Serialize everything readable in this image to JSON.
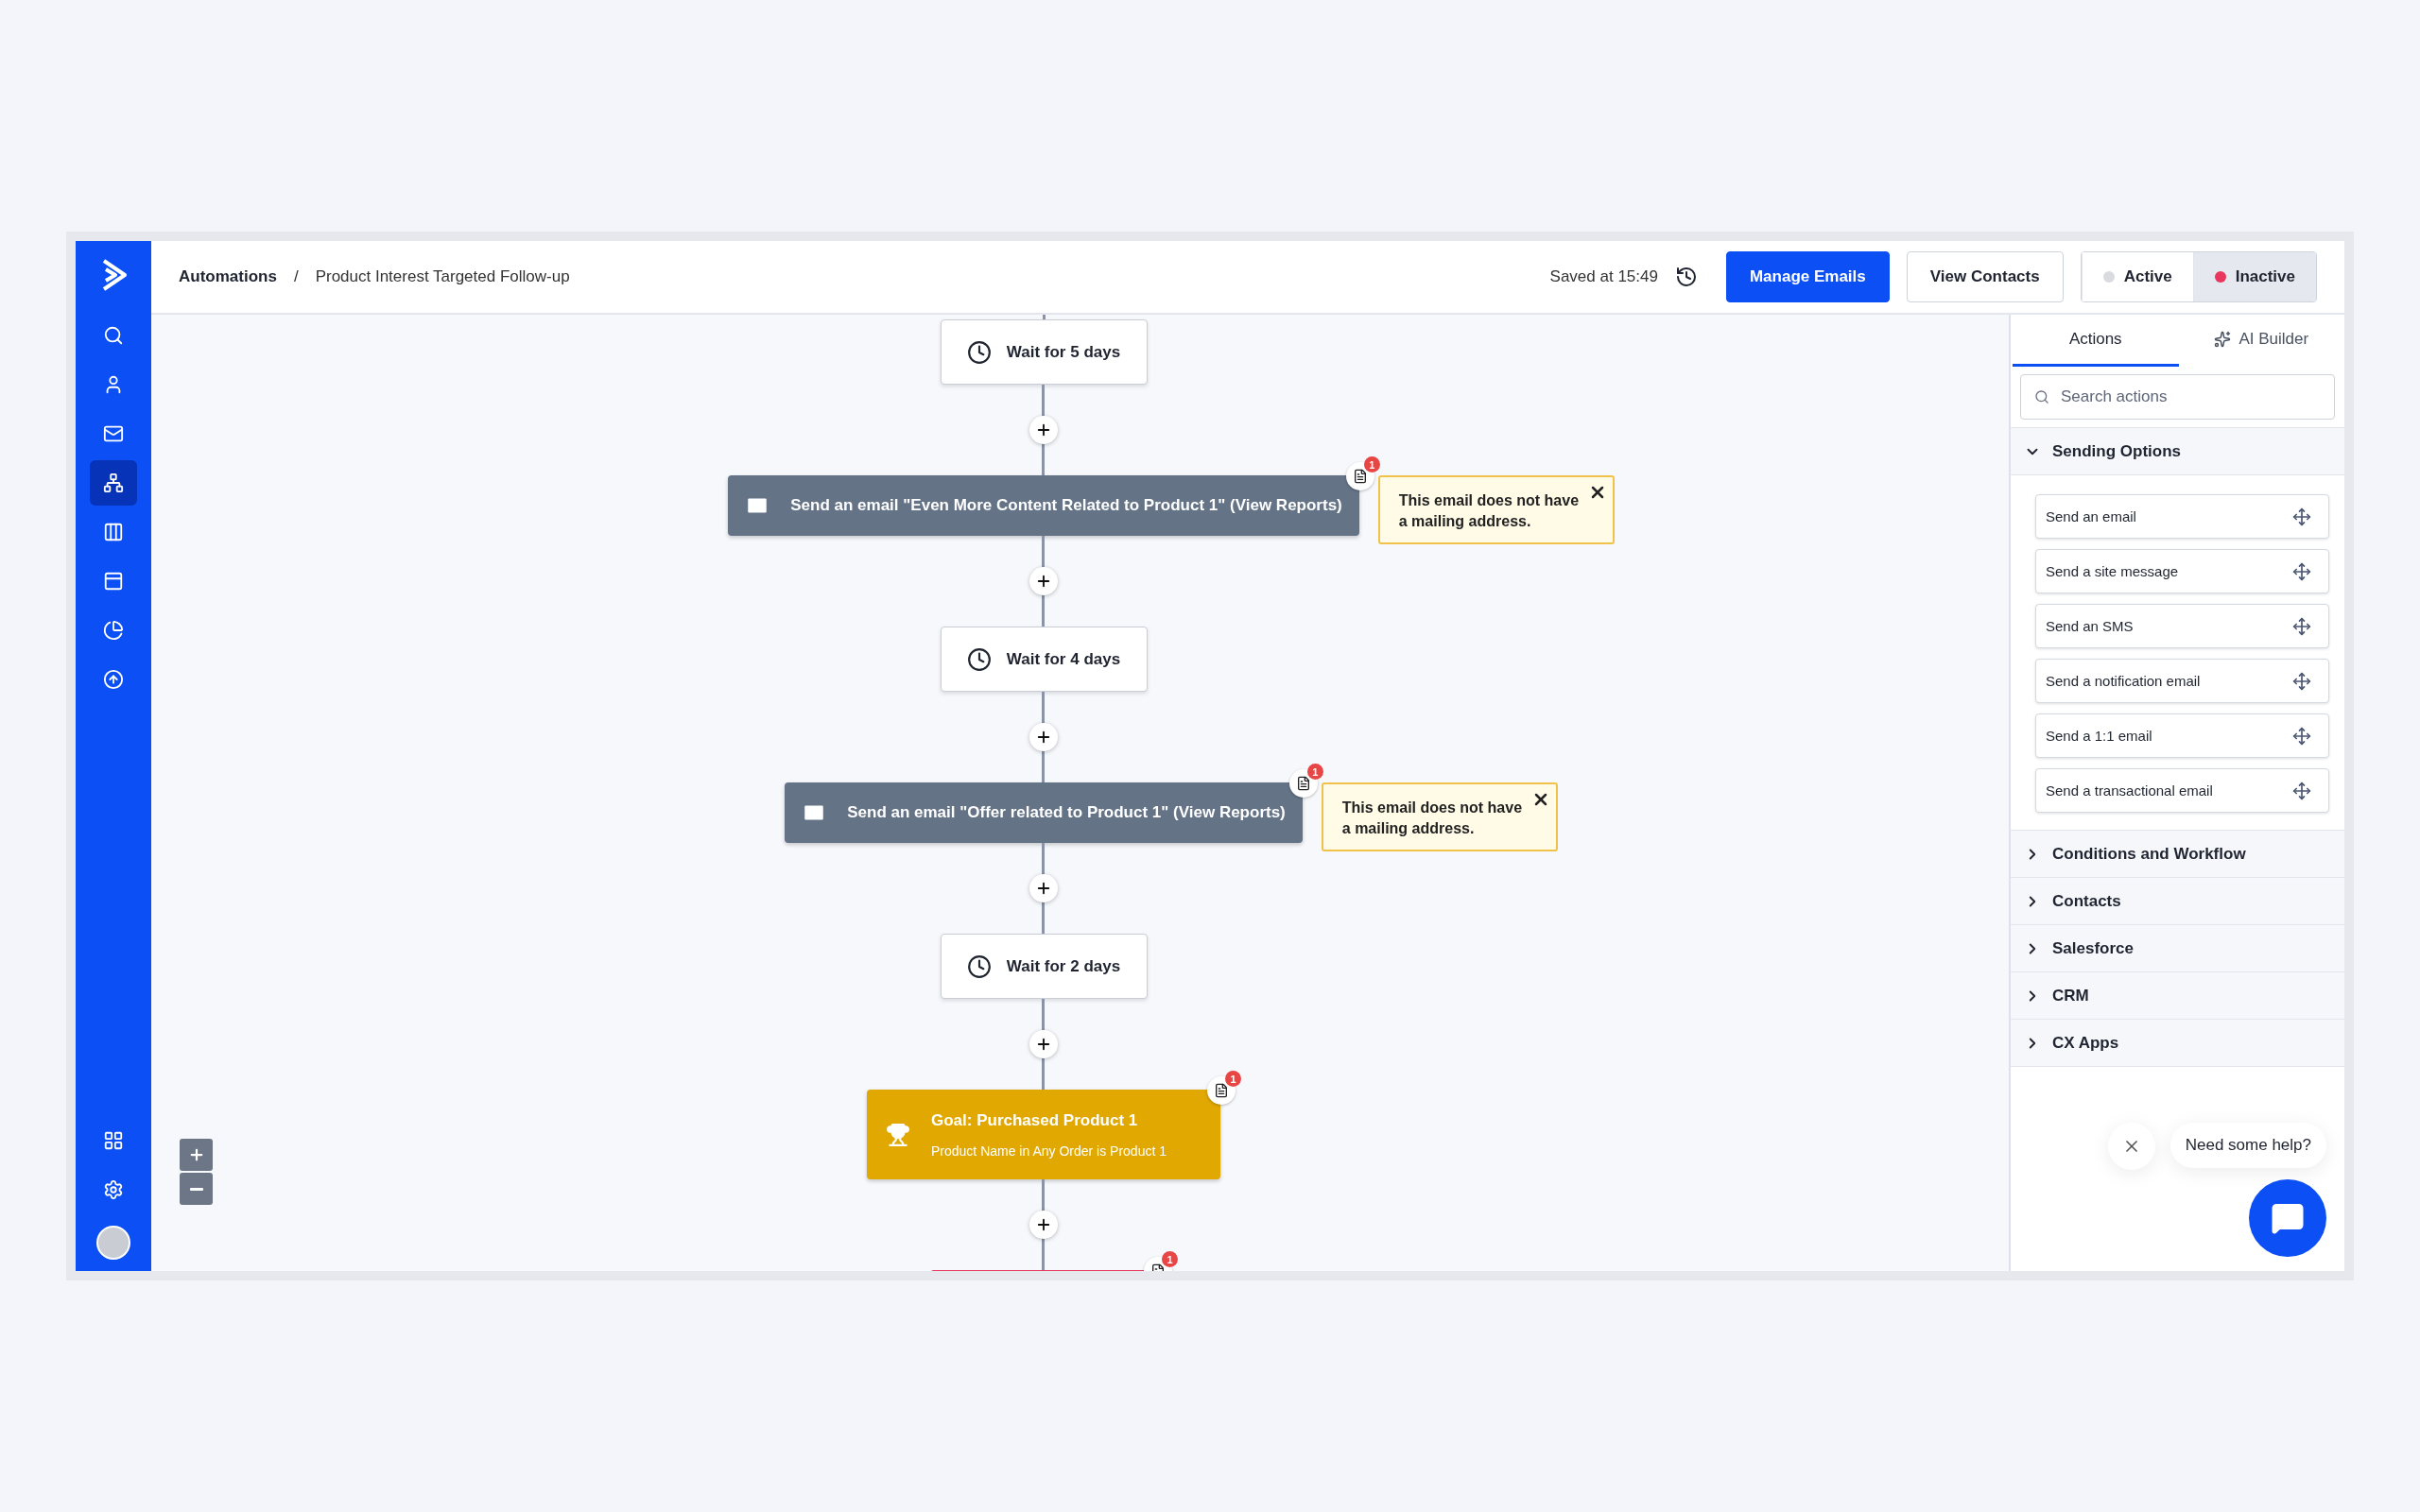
{
  "nav": [
    {
      "selected": false
    },
    {
      "selected": false
    },
    {
      "selected": false
    },
    {
      "selected": true
    },
    {
      "selected": false
    },
    {
      "selected": false
    },
    {
      "selected": false
    },
    {
      "selected": false
    }
  ],
  "breadcrumb": {
    "parent": "Automations",
    "separator": "/",
    "current": "Product Interest Targeted Follow-up"
  },
  "save_status": "Saved at 15:49",
  "buttons": [
    {
      "label": "Manage Emails",
      "kind": "primary"
    },
    {
      "label": "View Contacts",
      "kind": "secondary"
    }
  ],
  "status_toggle": [
    {
      "label": "Active",
      "selected": false,
      "color": "#d9dbe1"
    },
    {
      "label": "Inactive",
      "selected": true,
      "color": "#e8365c"
    }
  ],
  "flow": [
    {
      "kind": "wait",
      "label": "Wait for 5 days"
    },
    {
      "kind": "email",
      "label": "Send an email \"Even More Content Related to Product 1\" (View Reports)",
      "badge": "1",
      "warning": "This email does not have a mailing address."
    },
    {
      "kind": "wait",
      "label": "Wait for 4 days"
    },
    {
      "kind": "email",
      "label": "Send an email \"Offer related to Product 1\" (View Reports)",
      "badge": "1",
      "warning": "This email does not have a mailing address."
    },
    {
      "kind": "wait",
      "label": "Wait for 2 days"
    },
    {
      "kind": "goal",
      "title": "Goal: Purchased Product 1",
      "condition": "Product Name in Any Order is Product 1",
      "badge": "1"
    },
    {
      "kind": "cut",
      "badge": "1"
    }
  ],
  "panel": {
    "tabs": [
      {
        "label": "Actions",
        "selected": true
      },
      {
        "label": "AI Builder",
        "selected": false
      }
    ],
    "search": {
      "placeholder": "Search actions"
    },
    "sections": [
      {
        "title": "Sending Options",
        "expanded": true,
        "items": [
          "Send an email",
          "Send a site message",
          "Send an SMS",
          "Send a notification email",
          "Send a 1:1 email",
          "Send a transactional email"
        ]
      },
      {
        "title": "Conditions and Workflow",
        "expanded": false
      },
      {
        "title": "Contacts",
        "expanded": false
      },
      {
        "title": "Salesforce",
        "expanded": false
      },
      {
        "title": "CRM",
        "expanded": false
      },
      {
        "title": "CX Apps",
        "expanded": false
      }
    ]
  },
  "chat": {
    "prompt": "Need some help?"
  }
}
